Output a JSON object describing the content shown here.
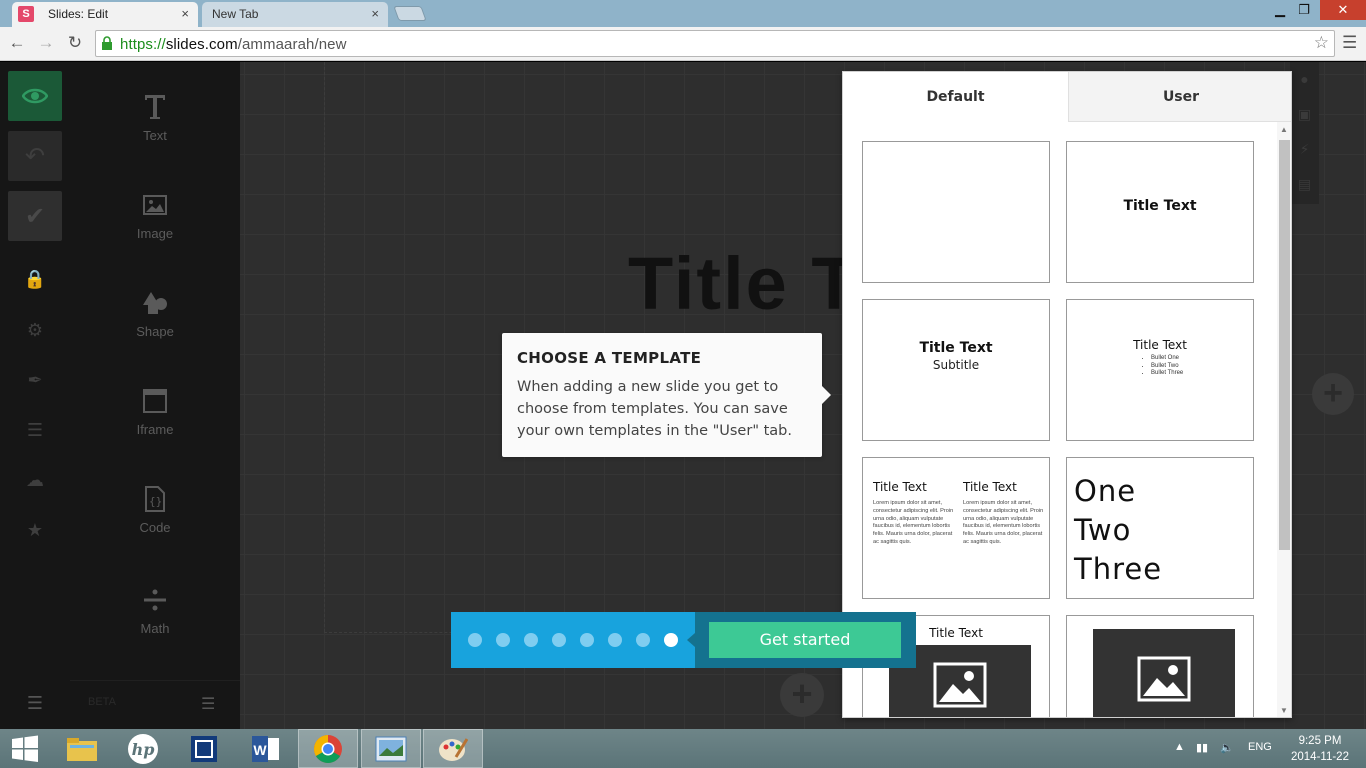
{
  "browser": {
    "tabs": [
      {
        "favicon": "S",
        "title": "Slides: Edit",
        "close": "×"
      },
      {
        "title": "New Tab",
        "close": "×"
      }
    ],
    "url_scheme": "https://",
    "url_host": "slides.com",
    "url_path": "/ammaarah/new",
    "window_controls": {
      "minimize": "▁",
      "maximize": "❐",
      "close": "✕"
    }
  },
  "editor": {
    "tools": [
      {
        "label": "Text",
        "icon": "text-icon"
      },
      {
        "label": "Image",
        "icon": "image-icon"
      },
      {
        "label": "Shape",
        "icon": "shape-icon"
      },
      {
        "label": "Iframe",
        "icon": "iframe-icon"
      },
      {
        "label": "Code",
        "icon": "code-icon"
      },
      {
        "label": "Math",
        "icon": "math-icon"
      }
    ],
    "beta_label": "BETA",
    "background_slide_title": "Title Te",
    "colors": {
      "preview": "#1b5937",
      "accent": "#18a3dd",
      "button": "#3dc995"
    }
  },
  "tooltip": {
    "title": "CHOOSE A TEMPLATE",
    "body": "When adding a new slide you get to choose from templates. You can save your own templates in the \"User\" tab."
  },
  "templates": {
    "tabs": {
      "default": "Default",
      "user": "User"
    },
    "title_text": "Title Text",
    "subtitle": "Subtitle",
    "bullets": [
      "Bullet One",
      "Bullet Two",
      "Bullet Three"
    ],
    "lorem": "Lorem ipsum dolor sit amet, consectetur adipiscing elit. Proin urna odio, aliquam vulputate faucibus id, elementum lobortis felis. Mauris urna dolor, placerat ac sagittis quis.",
    "big_list": [
      "One",
      "Two",
      "Three"
    ]
  },
  "onboarding": {
    "steps_total": 8,
    "current_step": 8,
    "cta": "Get started"
  },
  "taskbar": {
    "lang": "ENG",
    "time": "9:25 PM",
    "date": "2014-11-22"
  }
}
